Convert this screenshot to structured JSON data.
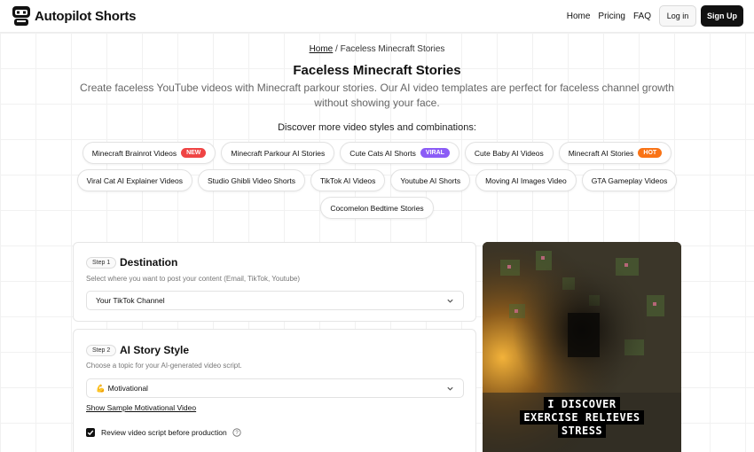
{
  "header": {
    "logo_text": "Autopilot Shorts",
    "nav": {
      "home": "Home",
      "pricing": "Pricing",
      "faq": "FAQ"
    },
    "login_label": "Log in",
    "signup_label": "Sign Up"
  },
  "hero": {
    "breadcrumb_home": "Home",
    "breadcrumb_sep": " / ",
    "breadcrumb_current": "Faceless Minecraft Stories",
    "title": "Faceless Minecraft Stories",
    "subtitle": "Create faceless YouTube videos with Minecraft parkour stories. Our AI video templates are perfect for faceless channel growth without showing your face.",
    "discover": "Discover more video styles and combinations:"
  },
  "chips": {
    "row1": [
      {
        "label": "Minecraft Brainrot Videos",
        "badge": "NEW",
        "badge_color": "#ef4444"
      },
      {
        "label": "Minecraft Parkour AI Stories"
      },
      {
        "label": "Cute Cats AI Shorts",
        "badge": "VIRAL",
        "badge_color": "#8b5cf6"
      },
      {
        "label": "Cute Baby AI Videos"
      },
      {
        "label": "Minecraft AI Stories",
        "badge": "HOT",
        "badge_color": "#f97316"
      }
    ],
    "row2": [
      {
        "label": "Viral Cat AI Explainer Videos"
      },
      {
        "label": "Studio Ghibli Video Shorts"
      },
      {
        "label": "TikTok AI Videos"
      },
      {
        "label": "Youtube AI Shorts"
      },
      {
        "label": "Moving AI Images Video"
      },
      {
        "label": "GTA Gameplay Videos"
      }
    ],
    "row3": [
      {
        "label": "Cocomelon Bedtime Stories"
      }
    ]
  },
  "step1": {
    "step": "Step 1",
    "title": "Destination",
    "desc": "Select where you want to post your content (Email, TikTok, Youtube)",
    "select_value": "Your TikTok Channel"
  },
  "step2": {
    "step": "Step 2",
    "title": "AI Story Style",
    "desc": "Choose a topic for your AI-generated video script.",
    "select_emoji": "💪",
    "select_value": "Motivational",
    "sample_link": "Show Sample Motivational Video",
    "checkbox_label": "Review video script before production",
    "checkbox_checked": true
  },
  "video": {
    "caption_lines": [
      "I DISCOVER",
      "EXERCISE RELIEVES",
      "STRESS"
    ]
  },
  "icons": {
    "logo": "robot-head-icon",
    "chevron": "chevron-down-icon",
    "help": "question-circle-icon",
    "check": "checkmark-icon"
  }
}
